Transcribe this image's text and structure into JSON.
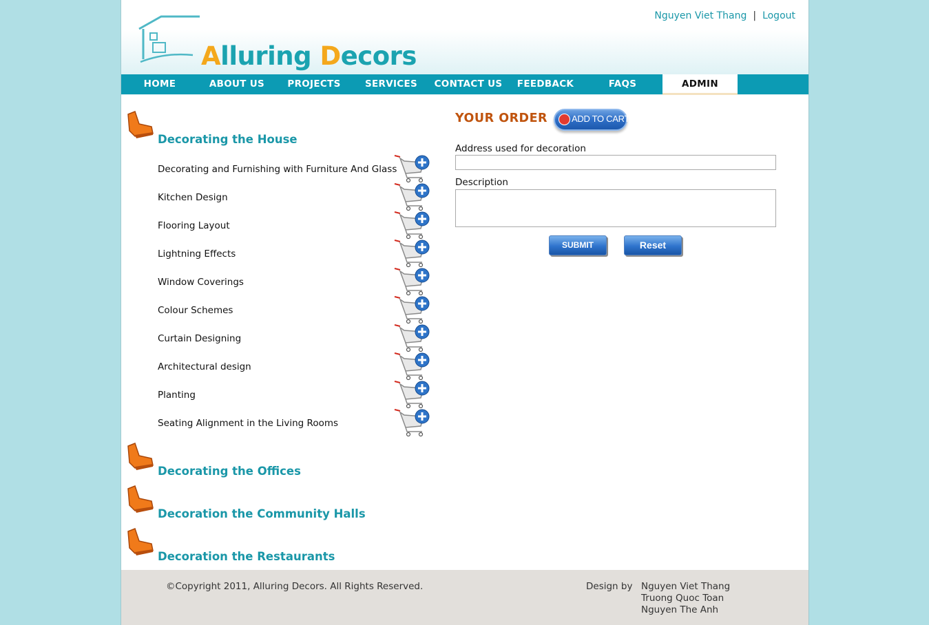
{
  "brand": {
    "logo_first_letter_1": "A",
    "logo_rest_1": "lluring ",
    "logo_first_letter_2": "D",
    "logo_rest_2": "ecors"
  },
  "user": {
    "name": "Nguyen Viet Thang",
    "separator": "|",
    "logout": "Logout"
  },
  "nav": {
    "items": [
      {
        "label": "HOME"
      },
      {
        "label": "ABOUT US"
      },
      {
        "label": "PROJECTS"
      },
      {
        "label": "SERVICES"
      },
      {
        "label": "CONTACT US"
      },
      {
        "label": "FEEDBACK"
      },
      {
        "label": "FAQS"
      },
      {
        "label": "ADMIN"
      }
    ],
    "active": "ADMIN"
  },
  "categories": {
    "house": {
      "title": "Decorating the House",
      "services": [
        "Decorating and Furnishing with Furniture And Glass",
        "Kitchen Design",
        "Flooring Layout",
        "Lightning Effects",
        "Window Coverings",
        "Colour Schemes",
        "Curtain Designing",
        "Architectural design",
        "Planting",
        "Seating Alignment in the Living Rooms"
      ]
    },
    "offices": {
      "title": "Decorating the Offices"
    },
    "halls": {
      "title": "Decoration the Community Halls"
    },
    "restaurants": {
      "title": "Decoration the Restaurants"
    }
  },
  "order": {
    "title": "YOUR ORDER",
    "add_to_cart": "ADD TO CART",
    "address_label": "Address used for decoration",
    "address_value": "",
    "description_label": "Description",
    "description_value": "",
    "submit": "SUBMIT",
    "reset": "Reset"
  },
  "footer": {
    "copyright": "©Copyright 2011, Alluring Decors. All Rights Reserved.",
    "design_by": "Design by",
    "designers": [
      "Nguyen Viet Thang",
      "Truong Quoc Toan",
      "Nguyen The Anh"
    ]
  },
  "colors": {
    "background": "#b0dfe5",
    "nav": "#0c9bb4",
    "accent_teal": "#1a97a8",
    "accent_orange": "#f4a81c",
    "order_title": "#c0540e",
    "footer": "#e2dfdb"
  }
}
